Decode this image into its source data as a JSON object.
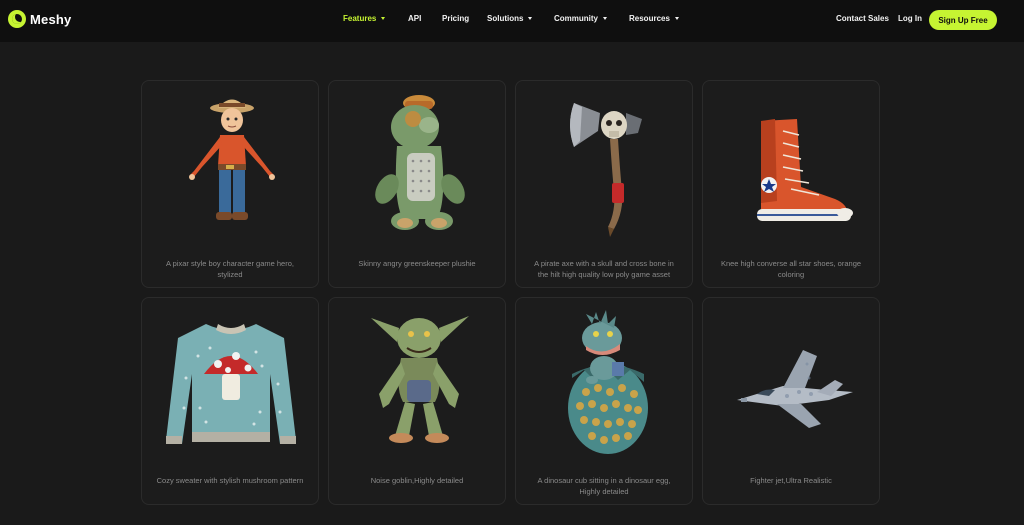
{
  "brand": {
    "name": "Meshy",
    "accent": "#c6f432"
  },
  "nav": {
    "items": [
      {
        "label": "Features",
        "active": true,
        "dropdown": true
      },
      {
        "label": "API",
        "active": false,
        "dropdown": false
      },
      {
        "label": "Pricing",
        "active": false,
        "dropdown": false
      },
      {
        "label": "Solutions",
        "active": false,
        "dropdown": true
      },
      {
        "label": "Community",
        "active": false,
        "dropdown": true
      },
      {
        "label": "Resources",
        "active": false,
        "dropdown": true
      }
    ],
    "contact_sales": "Contact Sales",
    "login": "Log In",
    "signup": "Sign Up Free"
  },
  "gallery": [
    {
      "caption": "A pixar style boy character game hero, stylized",
      "icon": "boy-character-model"
    },
    {
      "caption": "Skinny angry greenskeeper plushie",
      "icon": "plushie-model"
    },
    {
      "caption": "A pirate axe with a skull and cross bone in the hilt high quality low poly game asset",
      "icon": "pirate-axe-model"
    },
    {
      "caption": "Knee high converse all star shoes, orange coloring",
      "icon": "converse-shoe-model"
    },
    {
      "caption": "Cozy sweater with stylish mushroom pattern",
      "icon": "mushroom-sweater-model"
    },
    {
      "caption": "Noise goblin,Highly detailed",
      "icon": "goblin-model"
    },
    {
      "caption": "A dinosaur cub sitting in a dinosaur egg, Highly detailed",
      "icon": "dinosaur-egg-model"
    },
    {
      "caption": "Fighter jet,Ultra Realistic",
      "icon": "fighter-jet-model"
    }
  ]
}
